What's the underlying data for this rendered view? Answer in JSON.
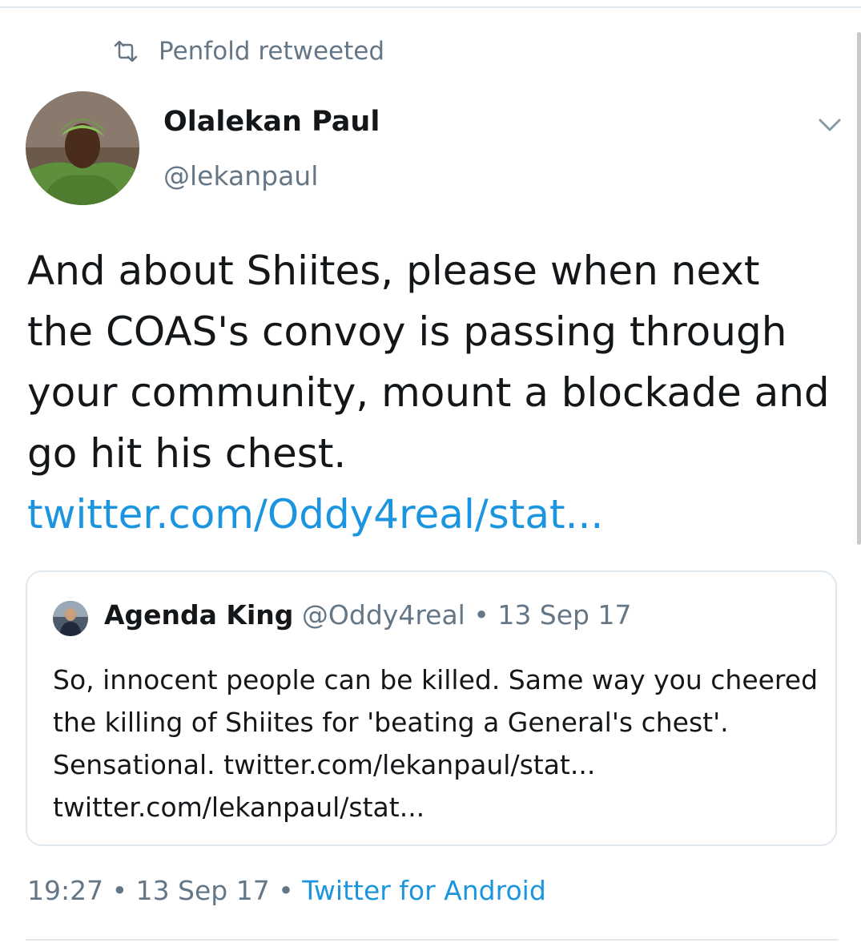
{
  "retweet": {
    "icon": "retweet-icon",
    "text": "Penfold retweeted"
  },
  "tweet": {
    "author": {
      "name": "Olalekan Paul",
      "handle": "@lekanpaul",
      "avatar": "avatar"
    },
    "menu_icon": "chevron-down-icon",
    "text": "And about Shiites, please when next the COAS's convoy is passing through your community, mount a blockade and go hit his chest.",
    "link": "twitter.com/Oddy4real/stat..."
  },
  "quote": {
    "author": {
      "name": "Agenda King",
      "handle": "@Oddy4real",
      "avatar": "avatar"
    },
    "separator": "•",
    "date": "13 Sep 17",
    "text": "So,  innocent people can be killed.  Same way you cheered the killing of Shiites for 'beating a General's chest'.  Sensational. twitter.com/lekanpaul/stat... twitter.com/lekanpaul/stat..."
  },
  "footer": {
    "time": "19:27",
    "separator": "•",
    "date": "13 Sep 17",
    "client": "Twitter for Android"
  },
  "colors": {
    "link": "#1b95e0",
    "muted": "#657786",
    "text": "#14171a",
    "divider": "#e1e8ed"
  }
}
